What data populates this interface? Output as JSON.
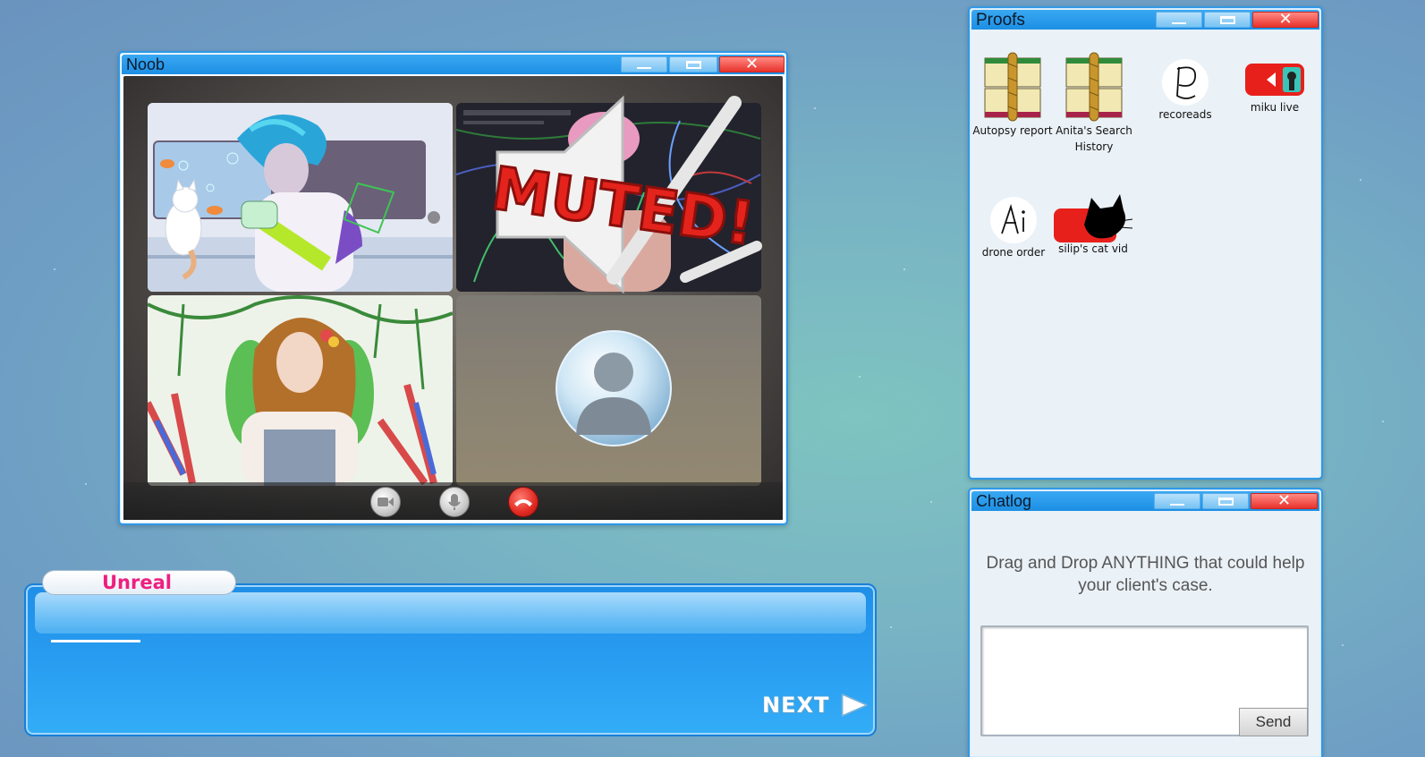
{
  "call_window": {
    "title": "Noob",
    "muted_label": "MUTED!",
    "controls": [
      "camera-icon",
      "microphone-icon",
      "hang-up-icon"
    ]
  },
  "dialog": {
    "speaker": "Unreal",
    "next_label": "NEXT"
  },
  "proofs_window": {
    "title": "Proofs",
    "items": [
      {
        "label": "Autopsy report",
        "icon": "book-icon"
      },
      {
        "label": "Anita's Search History",
        "icon": "book-icon"
      },
      {
        "label": "recoreads",
        "icon": "app-logo-icon"
      },
      {
        "label": "miku live",
        "icon": "video-icon"
      },
      {
        "label": "drone order",
        "icon": "app-logo-icon"
      },
      {
        "label": "silip's cat vid",
        "icon": "video-icon"
      }
    ]
  },
  "chatlog_window": {
    "title": "Chatlog",
    "hint": "Drag and Drop ANYTHING that could help your client's case.",
    "send_label": "Send"
  },
  "colors": {
    "accent": "#1c8fe4",
    "close": "#e8332c",
    "speaker": "#ee1f80"
  }
}
